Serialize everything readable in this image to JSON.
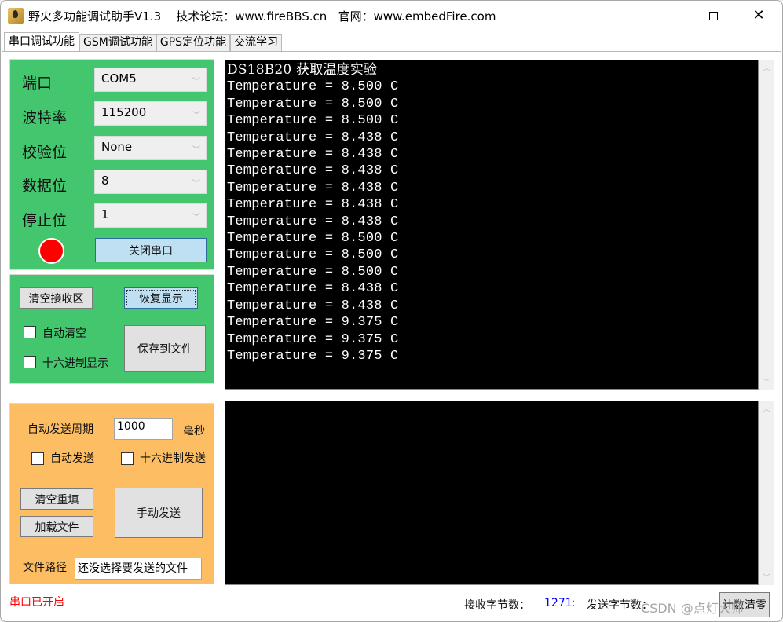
{
  "window": {
    "title": "野火多功能调试助手V1.3    技术论坛：www.fireBBS.cn   官网：www.embedFire.com",
    "controls": {
      "minimize": "—",
      "maximize": "□",
      "close": "✕"
    }
  },
  "tabs": [
    {
      "label": "串口调试功能",
      "active": true
    },
    {
      "label": "GSM调试功能",
      "active": false
    },
    {
      "label": "GPS定位功能",
      "active": false
    },
    {
      "label": "交流学习",
      "active": false
    }
  ],
  "port_settings": {
    "port": {
      "label": "端口",
      "value": "COM5"
    },
    "baud": {
      "label": "波特率",
      "value": "115200"
    },
    "parity": {
      "label": "校验位",
      "value": "None"
    },
    "databits": {
      "label": "数据位",
      "value": "8"
    },
    "stopbits": {
      "label": "停止位",
      "value": "1"
    },
    "status_led_color": "#ff0000",
    "close_port_label": "关闭串口"
  },
  "receive_controls": {
    "clear_label": "清空接收区",
    "restore_label": "恢复显示",
    "auto_clear_label": "自动清空",
    "auto_clear_checked": false,
    "hex_display_label": "十六进制显示",
    "hex_display_checked": false,
    "save_label": "保存到文件"
  },
  "send_controls": {
    "period_label": "自动发送周期",
    "period_value": "1000",
    "period_unit": "毫秒",
    "auto_send_label": "自动发送",
    "auto_send_checked": false,
    "hex_send_label": "十六进制发送",
    "hex_send_checked": false,
    "clear_refill_label": "清空重填",
    "load_file_label": "加载文件",
    "manual_send_label": "手动发送",
    "file_path_label": "文件路径",
    "file_path_value": "还没选择要发送的文件"
  },
  "receive_log": {
    "header": "DS18B20 获取温度实验",
    "lines": [
      "Temperature = 8.500 C",
      "Temperature = 8.500 C",
      "Temperature = 8.500 C",
      "Temperature = 8.438 C",
      "Temperature = 8.438 C",
      "Temperature = 8.438 C",
      "Temperature = 8.438 C",
      "Temperature = 8.438 C",
      "Temperature = 8.438 C",
      "Temperature = 8.500 C",
      "Temperature = 8.500 C",
      "Temperature = 8.500 C",
      "Temperature = 8.438 C",
      "Temperature = 8.438 C",
      "Temperature = 9.375 C",
      "Temperature = 9.375 C",
      "Temperature = 9.375 C"
    ]
  },
  "send_text": "",
  "status_bar": {
    "port_status": "串口已开启",
    "rx_count_label": "接收字节数：",
    "rx_count_value": "1271:",
    "tx_count_label": "发送字节数：",
    "reset_count_label": "计数清零",
    "watermark": "CSDN @点灯大师~",
    "port_status_color": "#ff0000",
    "rx_count_color": "#0000ff"
  },
  "colors": {
    "port_group_bg": "#44c66f",
    "send_group_bg": "#fdbd63",
    "terminal_bg": "#000000",
    "terminal_fg": "#ffffff"
  }
}
